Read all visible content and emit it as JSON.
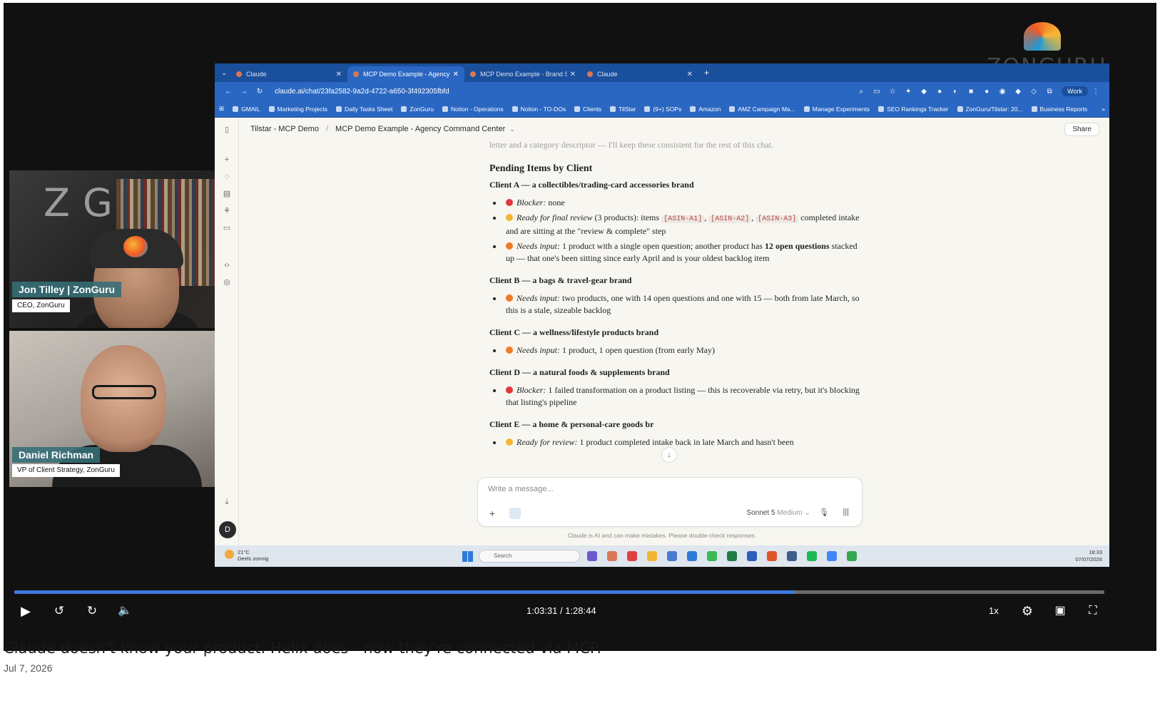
{
  "presenters": [
    {
      "name": "Jon Tilley | ZonGuru",
      "role": "CEO, ZonGuru",
      "backdrop_text": "ZG"
    },
    {
      "name": "Daniel Richman",
      "role": "VP of Client Strategy, ZonGuru"
    }
  ],
  "watermark": {
    "brand": "ZONGURU"
  },
  "browser": {
    "tabs": [
      {
        "label": "Claude",
        "active": false
      },
      {
        "label": "MCP Demo Example - Agency",
        "active": true
      },
      {
        "label": "MCP Demo Example - Brand Sr",
        "active": false
      },
      {
        "label": "Claude",
        "active": false
      }
    ],
    "url": "claude.ai/chat/23fa2582-9a2d-4722-a650-3f492305fbfd",
    "profile": "Work",
    "bookmarks": [
      "GMAIL",
      "Marketing Projects",
      "Daily Tasks Sheet",
      "ZonGuru",
      "Notion - Operations",
      "Notion - TO-DOs",
      "Clients",
      "TilStar",
      "(9+) SOPs",
      "Amazon",
      "AMZ Campaign Ma...",
      "Manage Experiments",
      "SEO Rankings Tracker",
      "ZonGuru/Tilstar: 20...",
      "Business Reports"
    ]
  },
  "claude": {
    "breadcrumb_project": "Tilstar - MCP Demo",
    "breadcrumb_chat": "MCP Demo Example - Agency Command Center",
    "share_label": "Share",
    "faded_line": "letter and a category descriptor — I'll keep these consistent for the rest of this chat.",
    "section_title": "Pending Items by Client",
    "clients": {
      "a_title": "Client A — a collectibles/trading-card accessories brand",
      "a1_label": "Blocker:",
      "a1_text": " none",
      "a2_label": "Ready for final review",
      "a2_text": " (3 products): items ",
      "a2_code1": "[ASIN-A1]",
      "a2_code2": "[ASIN-A2]",
      "a2_code3": "[ASIN-A3]",
      "a2_tail": " completed intake and are sitting at the \"review & complete\" step",
      "a3_label": "Needs input:",
      "a3_text": " 1 product with a single open question; another product has ",
      "a3_bold": "12 open questions",
      "a3_tail": " stacked up — that one's been sitting since early April and is your oldest backlog item",
      "b_title": "Client B — a bags & travel-gear brand",
      "b1_label": "Needs input:",
      "b1_text": " two products, one with 14 open questions and one with 15 — both from late March, so this is a stale, sizeable backlog",
      "c_title": "Client C — a wellness/lifestyle products brand",
      "c1_label": "Needs input:",
      "c1_text": " 1 product, 1 open question (from early May)",
      "d_title": "Client D — a natural foods & supplements brand",
      "d1_label": "Blocker:",
      "d1_text": " 1 failed transformation on a product listing — this is recoverable via retry, but it's blocking that listing's pipeline",
      "e_title": "Client E — a home & personal-care goods br",
      "e1_label": "Ready for review:",
      "e1_text": " 1 product completed intake back in late March and hasn't been"
    },
    "composer_placeholder": "Write a message...",
    "model": "Sonnet 5",
    "effort": "Medium",
    "disclaimer": "Claude is AI and can make mistakes. Please double-check responses."
  },
  "taskbar": {
    "weather_temp": "21°C",
    "weather_desc": "Deels zonnig",
    "search_label": "Search",
    "time": "18:33",
    "date": "07/07/2026"
  },
  "status_colors": {
    "blocker": "#e0393e",
    "ready": "#f2b632",
    "needs_input": "#f07a2a"
  },
  "player": {
    "time_label": "1:03:31 / 1:28:44",
    "progress_fraction": 0.716,
    "speed_label": "1x"
  },
  "video": {
    "title": "Claude doesn't know your product. Helix does - now they're connected via MCP.",
    "date": "Jul 7, 2026"
  }
}
